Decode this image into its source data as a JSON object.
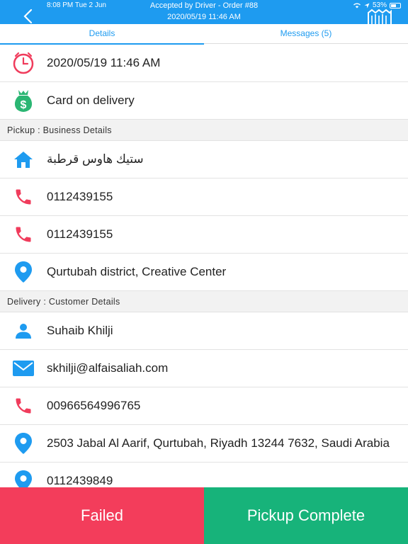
{
  "status_bar": {
    "time": "8:08 PM  Tue 2 Jun",
    "battery": "53%"
  },
  "header": {
    "title": "Accepted by Driver - Order #88",
    "subtitle": "2020/05/19 11:46 AM"
  },
  "tabs": [
    {
      "label": "Details"
    },
    {
      "label": "Messages (5)"
    }
  ],
  "order": {
    "datetime": "2020/05/19 11:46 AM",
    "payment": "Card on delivery"
  },
  "pickup": {
    "section_label": "Pickup : Business Details",
    "business_name": "ستيك هاوس قرطبة",
    "phone1": "0112439155",
    "phone2": "0112439155",
    "address": "Qurtubah district, Creative Center"
  },
  "delivery": {
    "section_label": "Delivery : Customer Details",
    "name": "Suhaib Khilji",
    "email": "skhilji@alfaisaliah.com",
    "phone": "00966564996765",
    "address": "2503 Jabal Al Aarif, Qurtubah, Riyadh 13244 7632, Saudi Arabia",
    "location_extra": "0112439849"
  },
  "actions": {
    "failed_label": "Failed",
    "complete_label": "Pickup Complete"
  },
  "colors": {
    "accent": "#1e9bf0",
    "phone_red": "#f03c5c",
    "failed": "#f33d5b",
    "complete": "#17b37a",
    "money_green": "#2bb673"
  }
}
